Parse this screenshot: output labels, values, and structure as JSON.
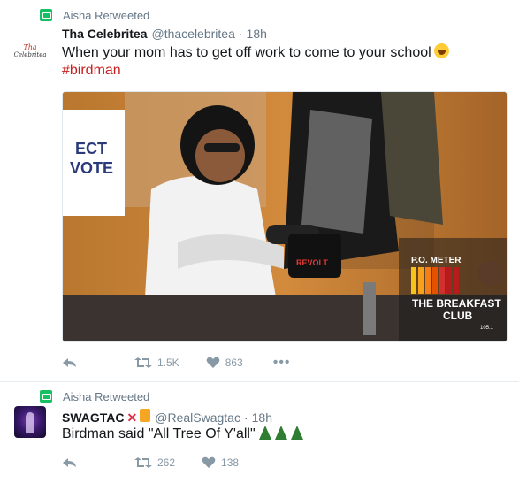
{
  "tweets": [
    {
      "retweeted_by": "Aisha Retweeted",
      "author_name": "Tha Celebritea",
      "handle": "@thacelebritea",
      "separator": "·",
      "time": "18h",
      "avatar_text_line1": "Tha",
      "avatar_text_line2": "Celebritea",
      "text": "When your mom has to get off work to come to your school",
      "hashtag": "#birdman",
      "media": {
        "mic_label": "REVOLT",
        "badge_line1": "P.O. METER",
        "badge_line2": "THE BREAKFAST",
        "badge_line3": "CLUB",
        "badge_line4": "105.1",
        "sign_text_1": "ECT",
        "sign_text_2": "VOTE"
      },
      "retweets": "1.5K",
      "likes": "863"
    },
    {
      "retweeted_by": "Aisha Retweeted",
      "author_name": "SWAGTAC",
      "handle": "@RealSwagtac",
      "separator": "·",
      "time": "18h",
      "cross_symbol": "✕",
      "text": "Birdman said \"All Tree Of Y'all\"",
      "retweets": "262",
      "likes": "138"
    }
  ],
  "colors": {
    "retweet_green": "#17bf63",
    "hashtag_red": "#c81e1e",
    "secondary_text": "#657786"
  },
  "icons": [
    "retweet-icon",
    "reply-icon",
    "retweet-action-icon",
    "heart-icon",
    "more-icon",
    "laughing-emoji-icon",
    "cross-mark-icon",
    "fuel-pump-icon",
    "evergreen-tree-icon"
  ]
}
